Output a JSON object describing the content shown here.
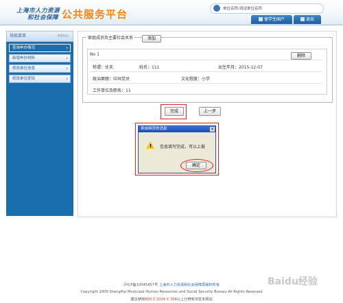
{
  "header": {
    "logo_line1": "上海市人力资源",
    "logo_line2": "和社会保障",
    "title": "公共服务平台",
    "user_text": "单位名称:测试单位名称",
    "tab_intl": "留学生国户",
    "tab_exit": "退出"
  },
  "sidebar": {
    "title": "导航菜单",
    "menu": "MENU",
    "items": [
      {
        "label": "查询申办情况"
      },
      {
        "label": "新增申办材料"
      },
      {
        "label": "修改单位信息"
      },
      {
        "label": "修改单位密码"
      }
    ]
  },
  "panel": {
    "title": "家庭成员及主要社会关系",
    "add_label": "添加",
    "no_label": "No 1",
    "delete_label": "删除",
    "relation": "称谓：丈夫",
    "name": "姓名：111",
    "birth": "出生年月：2015-12-07",
    "politics": "政治面貌：中共党员",
    "education": "文化程度：小学",
    "work": "工作单位及职务：11"
  },
  "actions": {
    "finish_label": "完成",
    "prev_label": "上一步"
  },
  "dialog": {
    "title": "来自网页的消息",
    "close": "×",
    "message": "信息填写完成，可以上报",
    "ok_label": "确定"
  },
  "footer": {
    "line1_prefix": "沪ICP备10045457号",
    "line1_link": "上海市人力资源和社会保障局版权所有",
    "line2": "Copyright 2009 ShangHai Municipal Human Resources and Social Security Bureau All Rights Reserved",
    "line3_prefix": "建议使用",
    "line3_red": "800 X 1024 X 768",
    "line3_suffix": "以上分辨率浏览本网站"
  },
  "watermark": "Baidu经验"
}
